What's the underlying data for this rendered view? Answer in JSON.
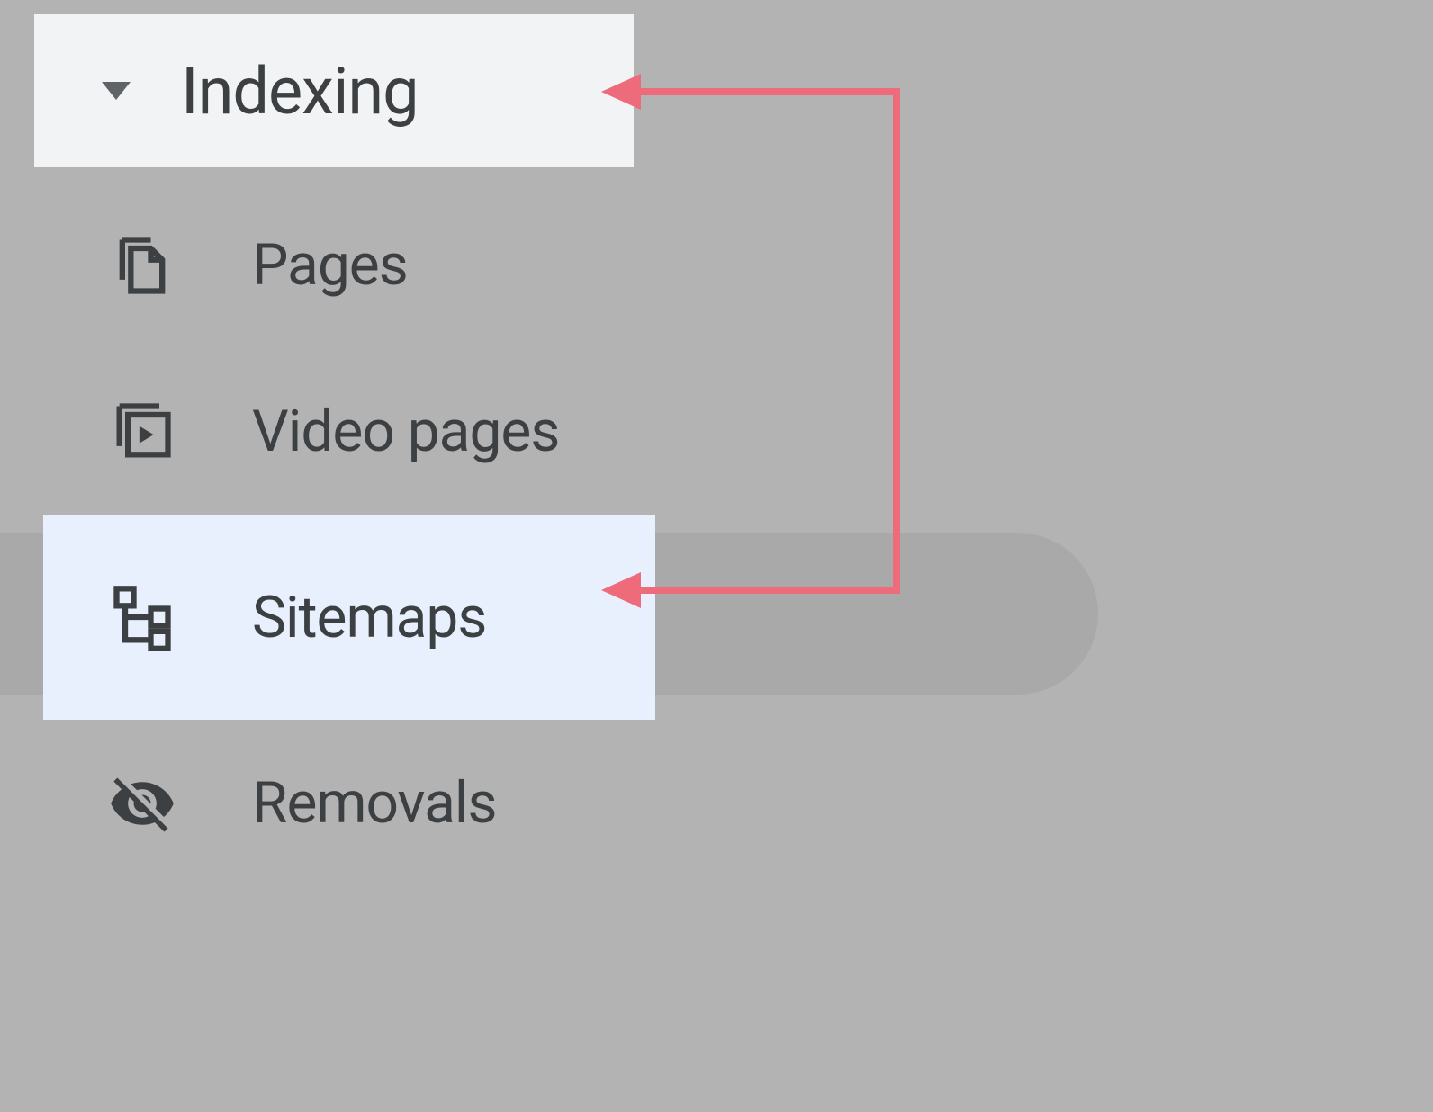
{
  "sidebar": {
    "section": {
      "title": "Indexing",
      "expanded": true
    },
    "items": [
      {
        "label": "Pages",
        "icon": "pages-icon",
        "selected": false
      },
      {
        "label": "Video pages",
        "icon": "video-pages-icon",
        "selected": false
      },
      {
        "label": "Sitemaps",
        "icon": "sitemaps-icon",
        "selected": true
      },
      {
        "label": "Removals",
        "icon": "removals-icon",
        "selected": false
      }
    ]
  },
  "annotation": {
    "color": "#ed6b7a"
  }
}
